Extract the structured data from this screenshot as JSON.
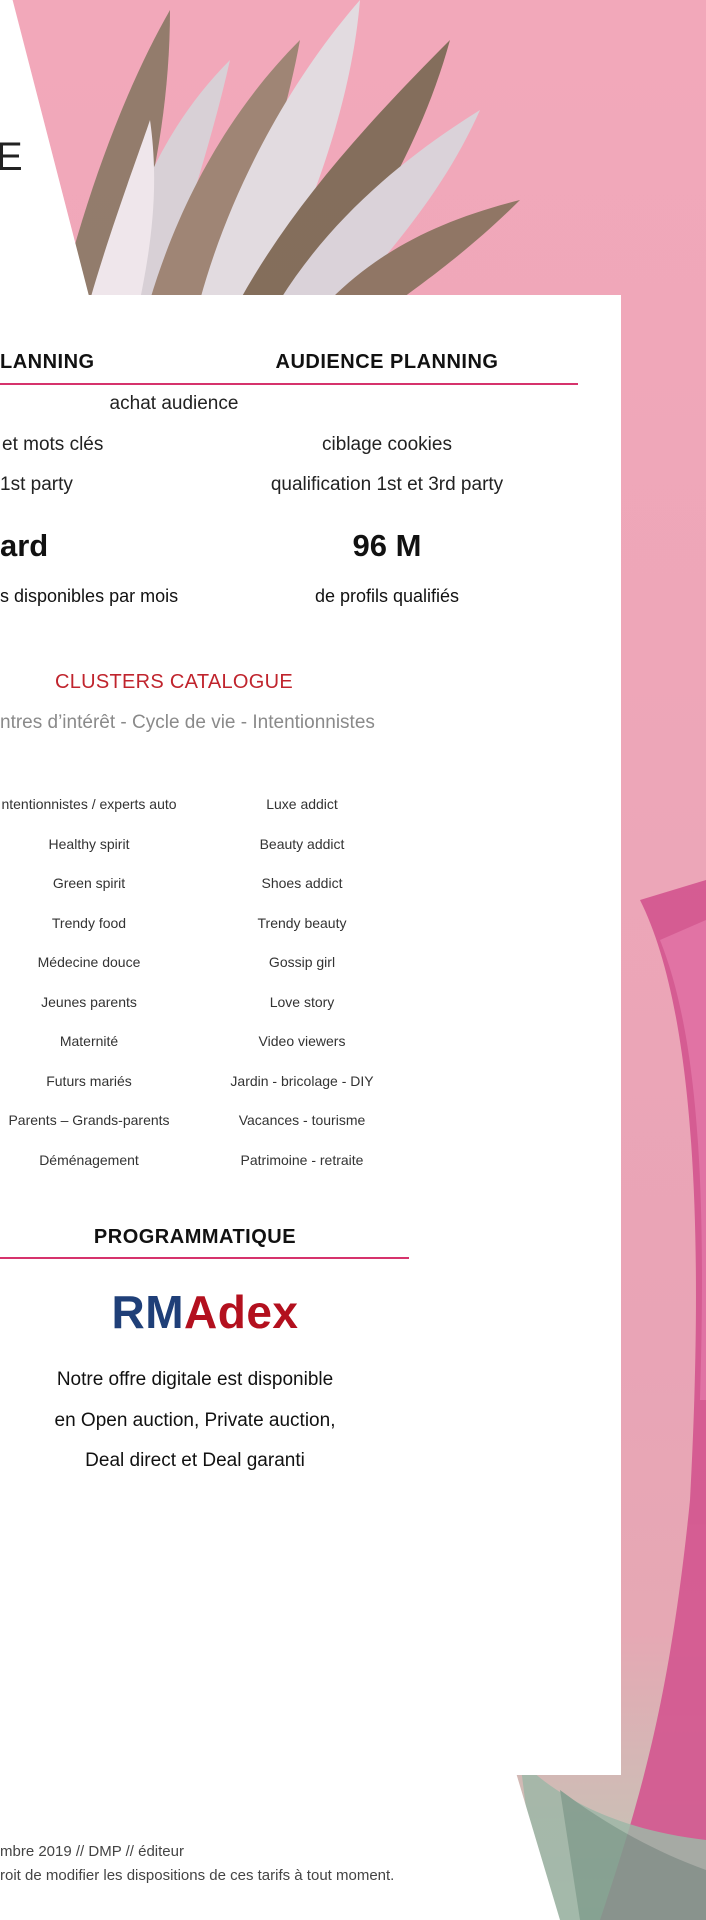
{
  "top_fragment": "E",
  "columns": {
    "left": {
      "heading": "LANNING",
      "lines": [
        "et mots clés",
        "1st party"
      ],
      "big_value": "ard",
      "big_caption": "s disponibles par mois"
    },
    "right": {
      "heading": "AUDIENCE  PLANNING",
      "lines": [
        "ciblage cookies",
        "qualification 1st et 3rd party"
      ],
      "big_value": "96 M",
      "big_caption": "de profils qualifiés"
    },
    "shared_line": "achat  audience"
  },
  "clusters": {
    "title": "CLUSTERS CATALOGUE",
    "subtitle": "ntres d’intérêt - Cycle de vie - Intentionnistes",
    "left_items": [
      "ntentionnistes / experts auto",
      "Healthy spirit",
      "Green spirit",
      "Trendy food",
      "Médecine douce",
      "Jeunes parents",
      "Maternité",
      "Futurs mariés",
      "Parents –  Grands-parents",
      "Déménagement"
    ],
    "right_items": [
      "Luxe addict",
      "Beauty addict",
      "Shoes addict",
      "Trendy beauty",
      "Gossip girl",
      "Love story",
      "Video viewers",
      "Jardin - bricolage - DIY",
      "Vacances - tourisme",
      "Patrimoine - retraite"
    ]
  },
  "programmatique": {
    "heading": "PROGRAMMATIQUE",
    "logo_rm": "RM",
    "logo_adex": "Adex",
    "offer_lines": [
      "Notre offre digitale est disponible",
      "en Open auction, Private auction,",
      "Deal direct et Deal garanti"
    ]
  },
  "footer": {
    "line1": "mbre 2019 // DMP // éditeur",
    "line2": "roit de modifier les dispositions de ces tarifs à tout moment."
  },
  "colors": {
    "accent_rule": "#d6336c",
    "cluster_title": "#c0242d",
    "logo_rm": "#1f3f78",
    "logo_adex": "#b3101e"
  }
}
